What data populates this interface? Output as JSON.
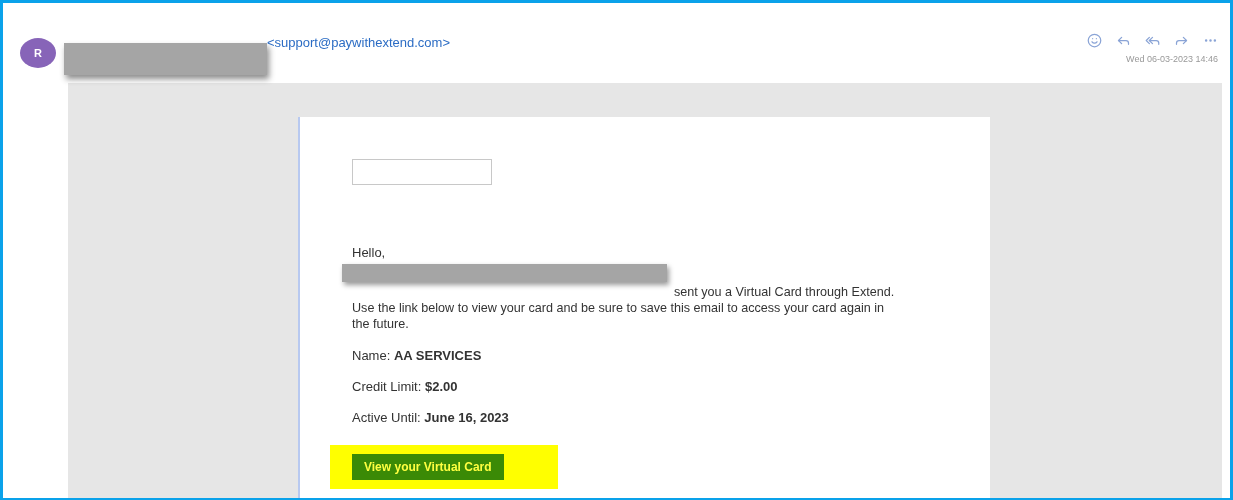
{
  "sender": {
    "avatar_initial": "R",
    "email": "<support@paywithextend.com>",
    "date": "Wed 06-03-2023 14:46"
  },
  "email": {
    "greeting": "Hello,",
    "message": "sent you a Virtual Card through Extend. Use the link below to view your card and be sure to save this email to access your card again in the future.",
    "details": [
      {
        "label": "Name:",
        "value": "AA SERVICES"
      },
      {
        "label": "Credit Limit:",
        "value": "$2.00"
      },
      {
        "label": "Active Until:",
        "value": "June 16, 2023"
      }
    ],
    "button": "View your Virtual Card"
  }
}
